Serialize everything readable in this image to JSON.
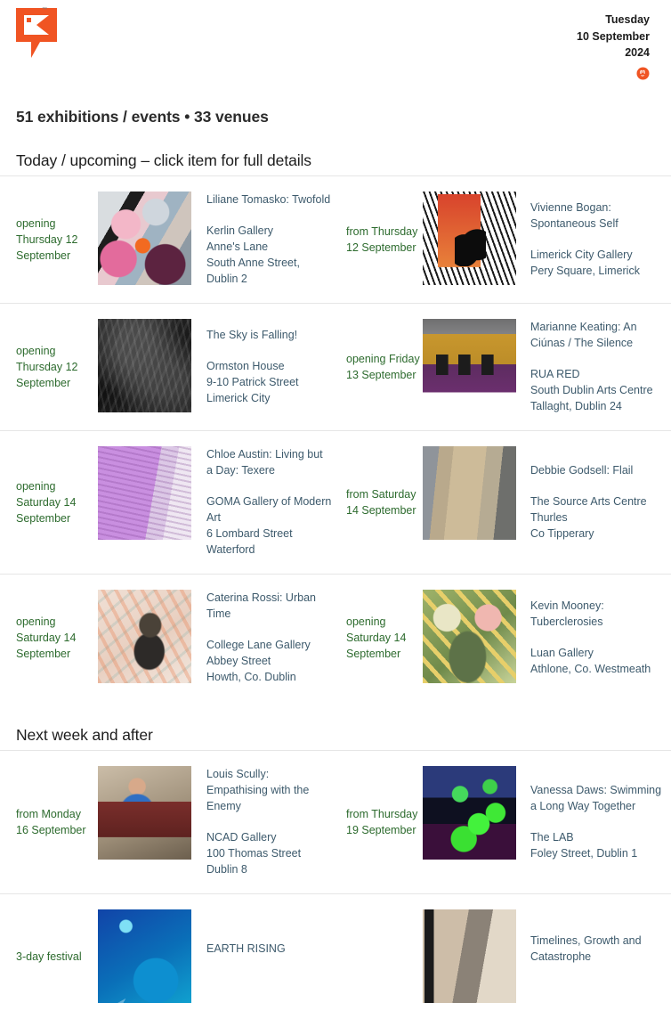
{
  "header": {
    "logo_name": "kunstpunkt-logo",
    "logo_tm": "™",
    "date_weekday": "Tuesday",
    "date_daymonth": "10 September",
    "date_year": "2024",
    "social_icon": "mastodon-icon",
    "colors": {
      "brand_orange": "#f05423",
      "date_green": "#2d6b2e",
      "text_blue": "#3d5a6c"
    }
  },
  "counts": "51 exhibitions / events • 33 venues",
  "sections": [
    {
      "id": "today",
      "heading": "Today / upcoming – click item for full details"
    },
    {
      "id": "next",
      "heading": "Next week and after"
    }
  ],
  "today_rows": [
    {
      "left": {
        "date": "opening\nThursday 12\nSeptember",
        "date_lines": [
          "opening",
          "Thursday 12",
          "September"
        ],
        "title": "Liliane Tomasko: Twofold",
        "venue_lines": [
          "Kerlin Gallery",
          "Anne's Lane",
          "South Anne Street, Dublin 2"
        ],
        "art": "art-tomasko"
      },
      "right": {
        "date_lines": [
          "from Thursday",
          "12 September"
        ],
        "title": "Vivienne Bogan: Spontaneous Self",
        "venue_lines": [
          "Limerick City Gallery",
          "Pery Square, Limerick"
        ],
        "art": "art-vivienne"
      }
    },
    {
      "left": {
        "date_lines": [
          "opening",
          "Thursday 12",
          "September"
        ],
        "title": "The Sky is Falling!",
        "venue_lines": [
          "Ormston House",
          "9-10 Patrick Street",
          "Limerick City"
        ],
        "art": "art-sky"
      },
      "right": {
        "date_lines": [
          "opening Friday",
          "13 September"
        ],
        "title": "Marianne Keating: An Ciúnas / The Silence",
        "venue_lines": [
          "RUA RED",
          "South Dublin Arts Centre",
          "Tallaght, Dublin 24"
        ],
        "art": "art-marianne"
      }
    },
    {
      "left": {
        "date_lines": [
          "opening",
          "Saturday 14",
          "September"
        ],
        "title": "Chloe Austin: Living but a Day: Texere",
        "venue_lines": [
          "GOMA Gallery of Modern Art",
          "6 Lombard Street",
          "Waterford"
        ],
        "art": "art-chloe"
      },
      "right": {
        "date_lines": [
          "from Saturday",
          "14 September"
        ],
        "title": "Debbie Godsell: Flail",
        "venue_lines": [
          "The Source Arts Centre",
          "Thurles",
          "Co Tipperary"
        ],
        "art": "art-debbie"
      }
    },
    {
      "left": {
        "date_lines": [
          "opening",
          "Saturday 14",
          "September"
        ],
        "title": "Caterina Rossi: Urban Time",
        "venue_lines": [
          "College Lane Gallery",
          "Abbey Street",
          "Howth, Co. Dublin"
        ],
        "art": "art-caterina"
      },
      "right": {
        "date_lines": [
          "opening",
          "Saturday 14",
          "September"
        ],
        "title": "Kevin Mooney: Tuberclerosies",
        "venue_lines": [
          "Luan Gallery",
          "Athlone, Co. Westmeath"
        ],
        "art": "art-kevin"
      }
    }
  ],
  "next_rows": [
    {
      "left": {
        "date_lines": [
          "from Monday",
          "16 September"
        ],
        "title": "Louis Scully: Empathising with the Enemy",
        "venue_lines": [
          "NCAD Gallery",
          "100 Thomas Street",
          "Dublin 8"
        ],
        "art": "art-louis"
      },
      "right": {
        "date_lines": [
          "from Thursday",
          "19 September"
        ],
        "title": "Vanessa Daws: Swimming a Long Way Together",
        "venue_lines": [
          "The LAB",
          "Foley Street, Dublin 1"
        ],
        "art": "art-vanessa"
      }
    },
    {
      "left": {
        "date_lines": [
          "3-day festival"
        ],
        "title": "EARTH RISING",
        "venue_lines": [],
        "art": "art-earth"
      },
      "right": {
        "date_lines": [],
        "title": "Timelines, Growth and Catastrophe",
        "venue_lines": [],
        "art": "art-timelines"
      }
    }
  ]
}
